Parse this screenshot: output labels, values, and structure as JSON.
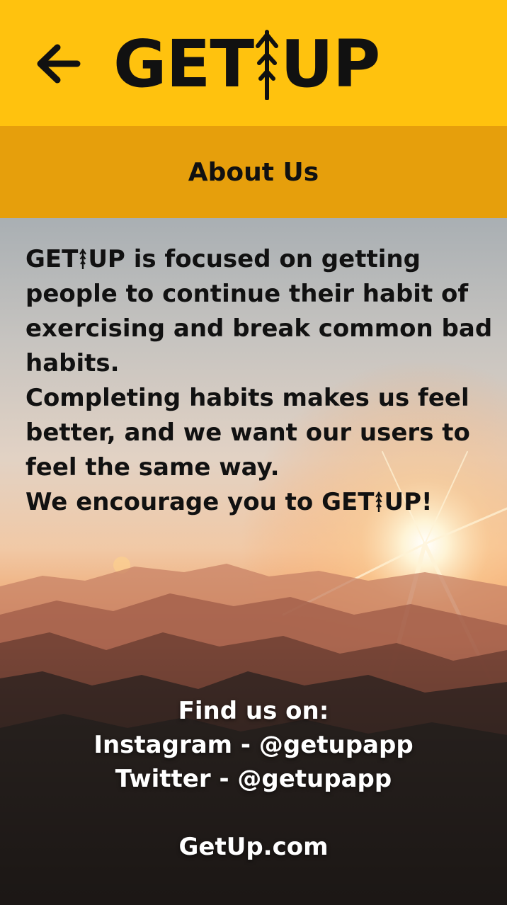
{
  "header": {
    "back_icon": "arrow-left-icon",
    "logo_left": "GET",
    "logo_mark_icon": "up-arrow-tree-icon",
    "logo_right": "UP",
    "background_color": "#FFC20E"
  },
  "subheader": {
    "title": "About Us",
    "background_color": "#E69F0C"
  },
  "about": {
    "brand_left": "GET",
    "brand_right": "UP",
    "line1_rest": " is focused on getting people to continue their habit of exercising and break common bad habits.",
    "line2": "Completing habits makes us feel better, and we want our users to feel the same way.",
    "line3_prefix": "We encourage you to ",
    "line3_brand_left": "GET",
    "line3_brand_right": "UP!"
  },
  "contact": {
    "heading": "Find us on:",
    "instagram": "Instagram - @getupapp",
    "twitter": "Twitter - @getupapp",
    "website": "GetUp.com"
  },
  "background_image": "sunset-over-mountains"
}
